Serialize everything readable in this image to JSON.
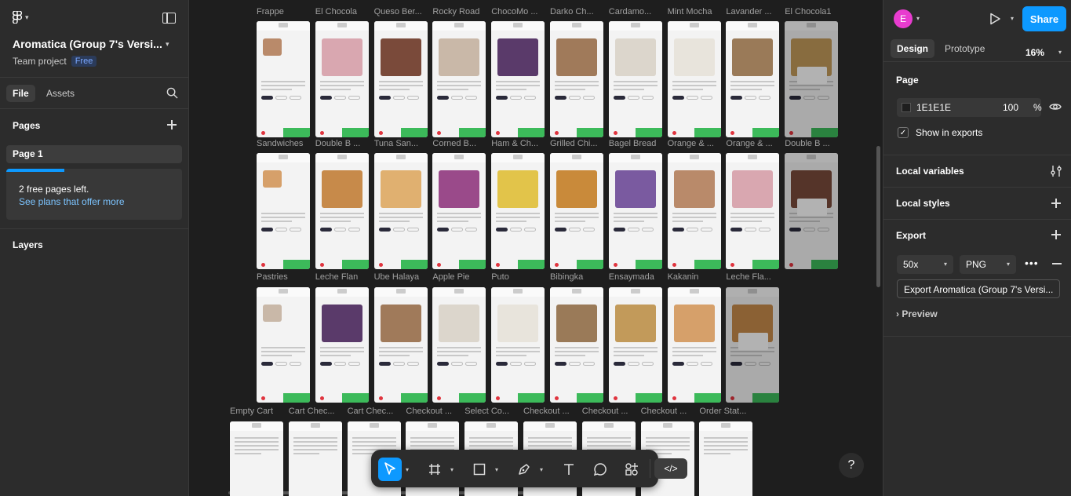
{
  "left_panel": {
    "file_title": "Aromatica (Group 7's Versi...",
    "team_label": "Team project",
    "plan_badge": "Free",
    "tabs": {
      "file": "File",
      "assets": "Assets"
    },
    "pages_heading": "Pages",
    "current_page": "Page 1",
    "free_pages_text": "2 free pages left.",
    "see_plans_link": "See plans that offer more",
    "free_pages_progress": 0.33,
    "layers_heading": "Layers"
  },
  "canvas": {
    "row1_labels": [
      "Frappe",
      "El Chocola",
      "Queso Ber...",
      "Rocky Road",
      "ChocoMo ...",
      "Darko Ch...",
      "Cardamo...",
      "Mint Mocha",
      "Lavander ...",
      "El Chocola1"
    ],
    "row2_labels": [
      "Sandwiches",
      "Double B ...",
      "Tuna San...",
      "Corned B...",
      "Ham & Ch...",
      "Grilled Chi...",
      "Bagel Bread",
      "Orange & ...",
      "Orange & ...",
      "Double B ..."
    ],
    "row3_labels": [
      "Pastries",
      "Leche Flan",
      "Ube Halaya",
      "Apple Pie",
      "Puto",
      "Bibingka",
      "Ensaymada",
      "Kakanin",
      "Leche Fla..."
    ],
    "row4_labels": [
      "Empty Cart",
      "Cart Chec...",
      "Cart Chec...",
      "Checkout ...",
      "Select Co...",
      "Checkout ...",
      "Checkout ...",
      "Checkout ...",
      "Order Stat..."
    ],
    "toolbar_dev_label": "</>",
    "help_label": "?"
  },
  "right_panel": {
    "avatar_initial": "E",
    "share_label": "Share",
    "tabs": {
      "design": "Design",
      "prototype": "Prototype"
    },
    "zoom": "16%",
    "page_section": "Page",
    "page_color": "1E1E1E",
    "page_opacity": "100",
    "percent_sign": "%",
    "show_in_exports": "Show in exports",
    "local_variables": "Local variables",
    "local_styles": "Local styles",
    "export_heading": "Export",
    "export_scale": "50x",
    "export_format": "PNG",
    "export_button": "Export Aromatica (Group 7's Versi...",
    "preview_label": "Preview"
  },
  "colors": {
    "accent": "#0d99ff",
    "avatar": "#e83ccf",
    "cart_green": "#3cba5a"
  }
}
